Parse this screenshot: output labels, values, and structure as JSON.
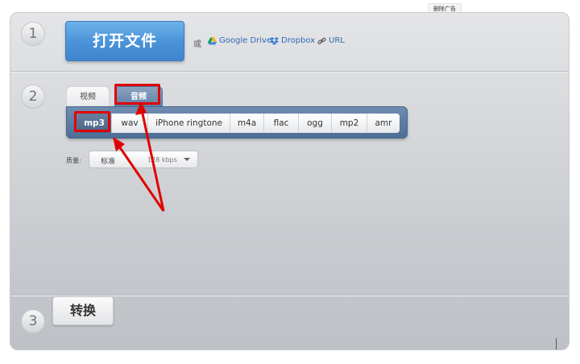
{
  "ad": {
    "remove_label": "删除广告"
  },
  "steps": {
    "one": "1",
    "two": "2",
    "three": "3"
  },
  "step1": {
    "open_button": "打开文件",
    "or_text": "或",
    "sources": [
      {
        "label": "Google Drive",
        "icon": "google-drive-icon"
      },
      {
        "label": "Dropbox",
        "icon": "dropbox-icon"
      },
      {
        "label": "URL",
        "icon": "link-icon"
      }
    ]
  },
  "step2": {
    "tabs": [
      {
        "label": "视频",
        "active": false
      },
      {
        "label": "音频",
        "active": true
      }
    ],
    "formats": [
      {
        "label": "mp3",
        "selected": true
      },
      {
        "label": "wav",
        "selected": false
      },
      {
        "label": "iPhone ringtone",
        "selected": false
      },
      {
        "label": "m4a",
        "selected": false
      },
      {
        "label": "flac",
        "selected": false
      },
      {
        "label": "ogg",
        "selected": false
      },
      {
        "label": "mp2",
        "selected": false
      },
      {
        "label": "amr",
        "selected": false
      }
    ],
    "quality": {
      "label": "质量:",
      "value": "标准",
      "bitrate": "128 kbps"
    }
  },
  "step3": {
    "convert_button": "转换"
  },
  "colors": {
    "primary_button": "#4a92d8",
    "tab_active": "#5f7fa6",
    "format_selected": "#4b6586",
    "annotation_red": "#e00000",
    "link": "#2f68b5"
  }
}
